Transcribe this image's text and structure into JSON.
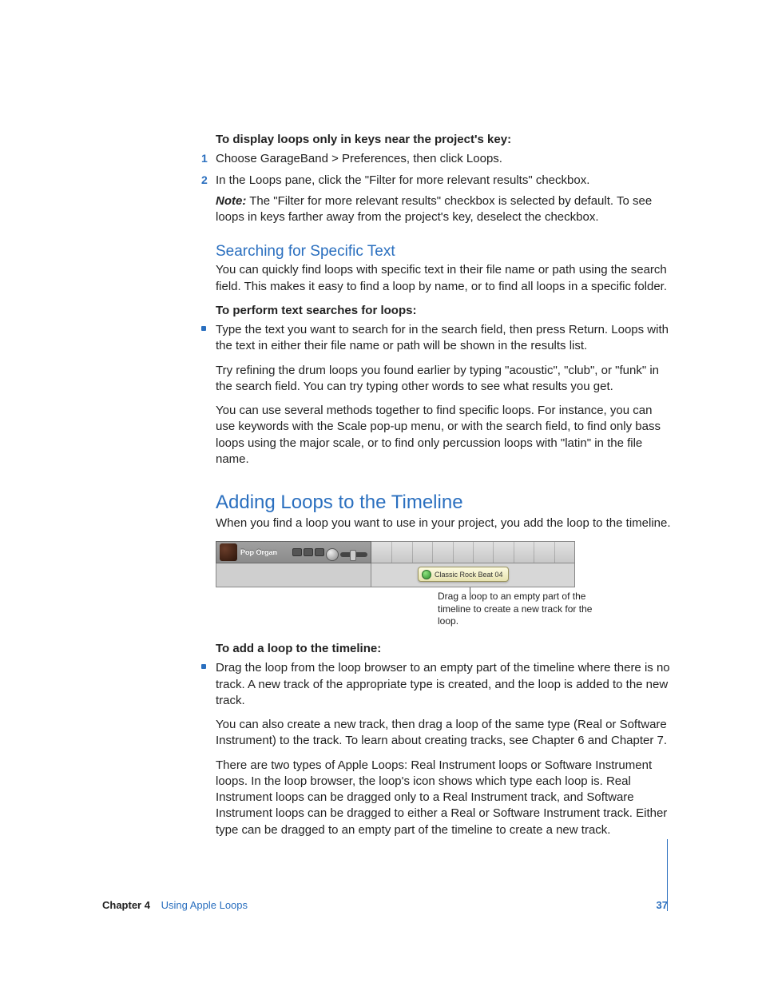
{
  "lead_in_1": "To display loops only in keys near the project's key:",
  "steps": [
    {
      "num": "1",
      "text": "Choose GarageBand > Preferences, then click Loops."
    },
    {
      "num": "2",
      "text": "In the Loops pane, click the \"Filter for more relevant results\" checkbox."
    }
  ],
  "note_label": "Note:",
  "note_text": "  The \"Filter for more relevant results\" checkbox is selected by default. To see loops in keys farther away from the project's key, deselect the checkbox.",
  "subhead_searching": "Searching for Specific Text",
  "searching_intro": "You can quickly find loops with specific text in their file name or path using the search field. This makes it easy to find a loop by name, or to find all loops in a specific folder.",
  "lead_in_2": "To perform text searches for loops:",
  "search_bullet": "Type the text you want to search for in the search field, then press Return. Loops with the text in either their file name or path will be shown in the results list.",
  "search_para1": "Try refining the drum loops you found earlier by typing \"acoustic\", \"club\", or \"funk\" in the search field. You can try typing other words to see what results you get.",
  "search_para2": "You can use several methods together to find specific loops. For instance, you can use keywords with the Scale pop-up menu, or with the search field, to find only bass loops using the major scale, or to find only percussion loops with \"latin\" in the file name.",
  "section_adding": "Adding Loops to the Timeline",
  "adding_intro": "When you find a loop you want to use in your project, you add the loop to the timeline.",
  "figure": {
    "track_name": "Pop Organ",
    "loop_chip": "Classic Rock Beat 04",
    "caption": "Drag a loop to an empty part of the timeline to create a new track for the loop."
  },
  "lead_in_3": "To add a loop to the timeline:",
  "add_bullet": "Drag the loop from the loop browser to an empty part of the timeline where there is no track. A new track of the appropriate type is created, and the loop is added to the new track.",
  "add_para1": "You can also create a new track, then drag a loop of the same type (Real or Software Instrument) to the track. To learn about creating tracks, see Chapter 6 and Chapter 7.",
  "add_para2": "There are two types of Apple Loops:  Real Instrument loops or Software Instrument loops. In the loop browser, the loop's icon shows which type each loop is. Real Instrument loops can be dragged only to a Real Instrument track, and Software Instrument loops can be dragged to either a Real or Software Instrument track. Either type can be dragged to an empty part of the timeline to create a new track.",
  "footer": {
    "chapter_label": "Chapter 4",
    "chapter_name": "Using Apple Loops",
    "page": "37"
  }
}
